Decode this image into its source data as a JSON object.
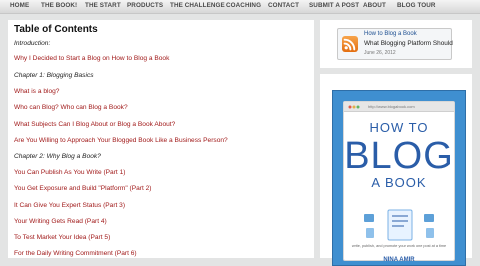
{
  "nav": {
    "items": [
      {
        "label": "HOME"
      },
      {
        "label": "THE BOOK!"
      },
      {
        "label": "THE START"
      },
      {
        "label": "PRODUCTS"
      },
      {
        "label": "THE CHALLENGE"
      },
      {
        "label": "COACHING"
      },
      {
        "label": "CONTACT"
      },
      {
        "label": "SUBMIT A POST"
      },
      {
        "label": "ABOUT"
      },
      {
        "label": "BLOG TOUR"
      }
    ]
  },
  "main": {
    "title": "Table of Contents",
    "lines": [
      {
        "text": "Introduction:"
      },
      {
        "text": "Why I Decided to Start a Blog on How to Blog a Book"
      },
      {
        "text": "Chapter 1: Blogging Basics"
      },
      {
        "text": "What is a blog?"
      },
      {
        "text": "Who can Blog? Who can Blog a Book?"
      },
      {
        "text": "What Subjects Can I Blog About or Blog a Book About?"
      },
      {
        "text": "Are You Willing to Approach Your Blogged Book Like a Business Person?"
      },
      {
        "text": "Chapter 2: Why Blog a Book?"
      },
      {
        "text": " You Can Publish As You Write (Part 1)"
      },
      {
        "text": "You Get Exposure and Build \"Platform\" (Part 2)"
      },
      {
        "text": " It Can Give You Expert Status (Part 3)"
      },
      {
        "text": "Your Writing Gets Read (Part 4)"
      },
      {
        "text": "To Test Market Your Idea (Part 5)"
      },
      {
        "text": " For the Daily Writing Commitment (Part 6)"
      }
    ]
  },
  "sidebar": {
    "rss": {
      "feed_title": "How to Blog a Book",
      "post_title": "What Blogging Platform Should",
      "date": "June 26, 2012"
    },
    "book": {
      "url": "http://www.blogabook.com",
      "line1": "HOW TO",
      "line2": "BLOG",
      "line3": "A BOOK",
      "tagline": "write, publish, and promote your work one post at a time",
      "author": "NINA AMIR"
    }
  },
  "colors": {
    "accent": "#a11a1a",
    "book_blue": "#3f8fd0",
    "rss_orange": "#f09a34"
  }
}
